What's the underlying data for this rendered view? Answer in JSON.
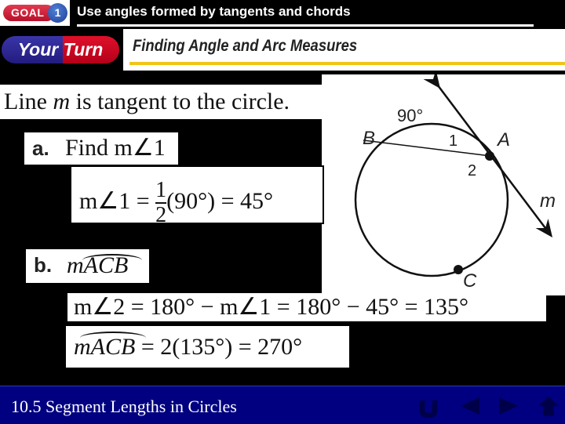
{
  "header": {
    "goal_label": "GOAL",
    "goal_number": "1",
    "title": "Use angles formed by tangents and chords",
    "your_turn_left": "Your",
    "your_turn_right": "Turn",
    "subtitle": "Finding Angle and Arc Measures"
  },
  "problem": {
    "statement_prefix": "Line ",
    "statement_var": "m",
    "statement_suffix": " is tangent to the circle.",
    "part_a": {
      "label": "a.",
      "question": "Find m∠1",
      "solution_lhs": "m∠1 =",
      "fraction_num": "1",
      "fraction_den": "2",
      "solution_rhs": "(90°) = 45°"
    },
    "part_b": {
      "label": "b.",
      "question": "mACB",
      "step1": "m∠2 = 180° − m∠1 = 180° − 45° = 135°",
      "step2_lhs": "mACB",
      "step2_rhs": " = 2(135°) = 270°"
    }
  },
  "diagram": {
    "arc_label": "90°",
    "point_a": "A",
    "point_b": "B",
    "point_c": "C",
    "angle_1": "1",
    "angle_2": "2",
    "line_label": "m"
  },
  "footer": {
    "section": "10.5   Segment Lengths in Circles",
    "nav": [
      "return-icon",
      "previous-icon",
      "next-icon",
      "home-icon"
    ]
  }
}
